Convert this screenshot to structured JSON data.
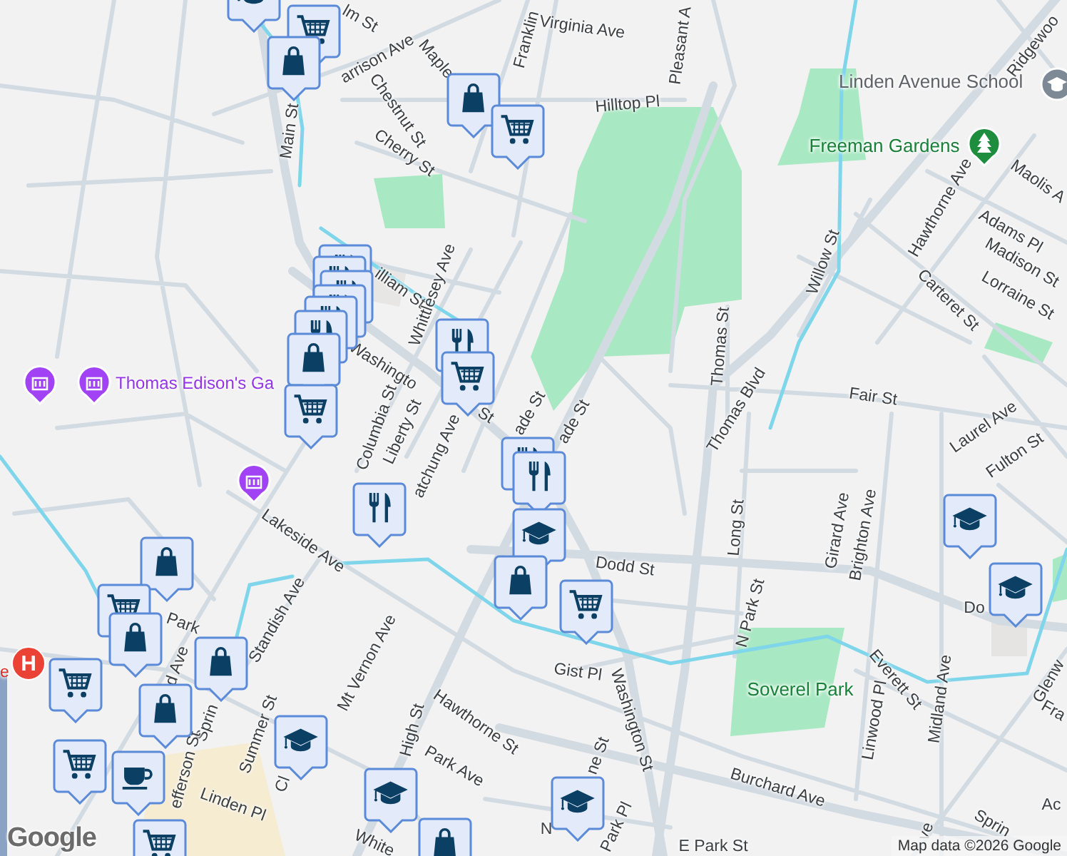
{
  "map": {
    "labels": [
      {
        "text": "Virginia Ave",
        "kind": "street"
      },
      {
        "text": "Franklin",
        "kind": "street"
      },
      {
        "text": "Maple",
        "kind": "street"
      },
      {
        "text": "lm St",
        "kind": "street"
      },
      {
        "text": "arrison Ave",
        "kind": "street"
      },
      {
        "text": "Chestnut St",
        "kind": "street"
      },
      {
        "text": "Cherry St",
        "kind": "street"
      },
      {
        "text": "Hilltop Pl",
        "kind": "street"
      },
      {
        "text": "Pleasant A",
        "kind": "street"
      },
      {
        "text": "Main St",
        "kind": "street"
      },
      {
        "text": "illiam St",
        "kind": "street"
      },
      {
        "text": "Whittlesey Ave",
        "kind": "street"
      },
      {
        "text": "Washingto",
        "kind": "street"
      },
      {
        "text": "St",
        "kind": "street"
      },
      {
        "text": "Columbia St",
        "kind": "street"
      },
      {
        "text": "Liberty St",
        "kind": "street"
      },
      {
        "text": "atchung Ave",
        "kind": "street"
      },
      {
        "text": "ade St",
        "kind": "street"
      },
      {
        "text": "ade St",
        "kind": "street"
      },
      {
        "text": "Thomas St",
        "kind": "street"
      },
      {
        "text": "Thomas Blvd",
        "kind": "street"
      },
      {
        "text": "Willow St",
        "kind": "street"
      },
      {
        "text": "Carteret St",
        "kind": "street"
      },
      {
        "text": "Hawthorne Ave",
        "kind": "street"
      },
      {
        "text": "Adams Pl",
        "kind": "street"
      },
      {
        "text": "Madison St",
        "kind": "street"
      },
      {
        "text": "Lorraine St",
        "kind": "street"
      },
      {
        "text": "Maolis A",
        "kind": "street"
      },
      {
        "text": "Ridgewoo",
        "kind": "street"
      },
      {
        "text": "Fair St",
        "kind": "street"
      },
      {
        "text": "Laurel Ave",
        "kind": "street"
      },
      {
        "text": "Fulton St",
        "kind": "street"
      },
      {
        "text": "Lakeside Ave",
        "kind": "street"
      },
      {
        "text": "Dodd St",
        "kind": "street"
      },
      {
        "text": "Do",
        "kind": "street"
      },
      {
        "text": "Long St",
        "kind": "street"
      },
      {
        "text": "N Park St",
        "kind": "street"
      },
      {
        "text": "Girard Ave",
        "kind": "street"
      },
      {
        "text": "Brighton Ave",
        "kind": "street"
      },
      {
        "text": "Standish Ave",
        "kind": "street"
      },
      {
        "text": "Park",
        "kind": "street"
      },
      {
        "text": "d Ave",
        "kind": "street"
      },
      {
        "text": "Sprin",
        "kind": "street"
      },
      {
        "text": "Mt Vernon Ave",
        "kind": "street"
      },
      {
        "text": "Gist Pl",
        "kind": "street"
      },
      {
        "text": "Washington St",
        "kind": "street"
      },
      {
        "text": "Summer St",
        "kind": "street"
      },
      {
        "text": "Hawthorne St",
        "kind": "street"
      },
      {
        "text": "High St",
        "kind": "street"
      },
      {
        "text": "Park Ave",
        "kind": "street"
      },
      {
        "text": "Everett St",
        "kind": "street"
      },
      {
        "text": "Linwood Pl",
        "kind": "street"
      },
      {
        "text": "Midland Ave",
        "kind": "street"
      },
      {
        "text": "Glenw",
        "kind": "street"
      },
      {
        "text": "Fra",
        "kind": "street"
      },
      {
        "text": "Burchard Ave",
        "kind": "street"
      },
      {
        "text": "efferson St",
        "kind": "street"
      },
      {
        "text": "Linden Pl",
        "kind": "street"
      },
      {
        "text": "Cl",
        "kind": "street"
      },
      {
        "text": "White",
        "kind": "street"
      },
      {
        "text": "ne St",
        "kind": "street"
      },
      {
        "text": "N",
        "kind": "street"
      },
      {
        "text": "Park Pl",
        "kind": "street"
      },
      {
        "text": "E Park St",
        "kind": "street"
      },
      {
        "text": "Sprin",
        "kind": "street"
      },
      {
        "text": "Ac",
        "kind": "street"
      },
      {
        "text": "ve",
        "kind": "street"
      },
      {
        "text": "Thomas Edison's Ga",
        "kind": "museum"
      },
      {
        "text": "Linden Avenue School",
        "kind": "school"
      },
      {
        "text": "Freeman Gardens",
        "kind": "park"
      },
      {
        "text": "Soverel Park",
        "kind": "park"
      },
      {
        "text": "e",
        "kind": "hospital"
      }
    ],
    "markers": [
      {
        "kind": "museum"
      },
      {
        "kind": "museum"
      },
      {
        "kind": "museum"
      },
      {
        "kind": "hospital",
        "glyph": "H"
      },
      {
        "kind": "park"
      },
      {
        "kind": "school"
      }
    ],
    "pins": [
      {
        "kind": "school"
      },
      {
        "kind": "stack",
        "pins": [
          {
            "kind": "cart"
          },
          {
            "kind": "bag"
          }
        ]
      },
      {
        "kind": "bag"
      },
      {
        "kind": "cart"
      },
      {
        "kind": "stack",
        "pins": [
          {
            "kind": "food"
          },
          {
            "kind": "food"
          },
          {
            "kind": "food"
          },
          {
            "kind": "food"
          },
          {
            "kind": "food"
          },
          {
            "kind": "food"
          },
          {
            "kind": "bag"
          },
          {
            "kind": "cart"
          }
        ]
      },
      {
        "kind": "stack",
        "pins": [
          {
            "kind": "food"
          },
          {
            "kind": "cart"
          }
        ]
      },
      {
        "kind": "food"
      },
      {
        "kind": "stack",
        "pins": [
          {
            "kind": "food"
          },
          {
            "kind": "food"
          },
          {
            "kind": "school"
          },
          {
            "kind": "bag"
          }
        ]
      },
      {
        "kind": "cart"
      },
      {
        "kind": "stack",
        "pins": [
          {
            "kind": "bag"
          },
          {
            "kind": "cart"
          },
          {
            "kind": "bag"
          }
        ]
      },
      {
        "kind": "cart"
      },
      {
        "kind": "bag"
      },
      {
        "kind": "bag"
      },
      {
        "kind": "cart"
      },
      {
        "kind": "cup"
      },
      {
        "kind": "school"
      },
      {
        "kind": "school"
      },
      {
        "kind": "bag"
      },
      {
        "kind": "cart"
      },
      {
        "kind": "school"
      },
      {
        "kind": "school"
      },
      {
        "kind": "school"
      }
    ],
    "logo": "Google",
    "attribution": "Map data ©2026 Google"
  }
}
